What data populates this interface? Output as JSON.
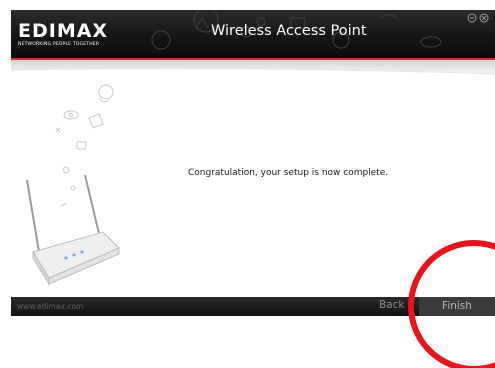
{
  "header": {
    "brand": "EDIMAX",
    "brand_tagline": "NETWORKING PEOPLE TOGETHER",
    "title": "Wireless Access Point"
  },
  "window_controls": {
    "minimize_icon": "minus-circle-icon",
    "close_icon": "x-circle-icon"
  },
  "main": {
    "message": "Congratulation, your setup is now complete."
  },
  "footer": {
    "url": "www.edimax.com",
    "back_label": "Back",
    "finish_label": "Finish"
  },
  "colors": {
    "accent": "#d63030",
    "annotation": "#e8141c",
    "header_bg": "#141414",
    "footer_bg": "#1b1b1b"
  }
}
